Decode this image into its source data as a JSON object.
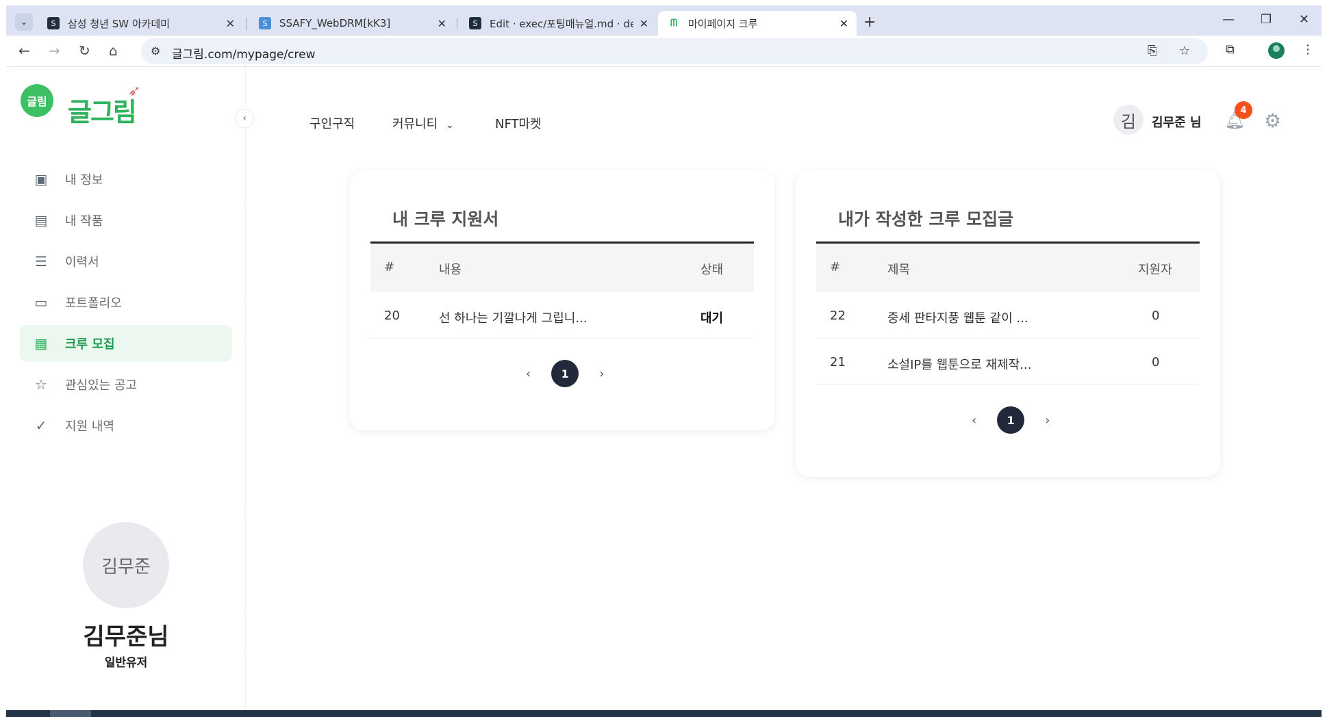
{
  "browser": {
    "tabs": [
      {
        "title": "삼성 청년 SW 아카데미",
        "favicon_color": "#1f2d3d"
      },
      {
        "title": "SSAFY_WebDRM[kK3]",
        "favicon_color": "#4a8fd8"
      },
      {
        "title": "Edit · exec/포팅매뉴얼.md · de",
        "favicon_color": "#1f2d3d"
      },
      {
        "title": "마이페이지 크루",
        "favicon_color": "#2db35b"
      }
    ],
    "url": "글그림.com/mypage/crew"
  },
  "sidebar": {
    "logo_mark": "글림",
    "logo_text": "글그림",
    "items": [
      {
        "label": "내 정보",
        "icon": "person-card-icon"
      },
      {
        "label": "내 작품",
        "icon": "archive-box-icon"
      },
      {
        "label": "이력서",
        "icon": "resume-list-icon"
      },
      {
        "label": "포트폴리오",
        "icon": "presentation-icon"
      },
      {
        "label": "크루 모집",
        "icon": "calendar-icon"
      },
      {
        "label": "관심있는 공고",
        "icon": "star-icon"
      },
      {
        "label": "지원 내역",
        "icon": "check-circle-icon"
      }
    ],
    "active_index": 4,
    "profile": {
      "avatar_text": "김무준",
      "name": "김무준님",
      "role": "일반유저"
    }
  },
  "topnav": {
    "items": [
      "구인구직",
      "커뮤니티",
      "NFT마켓"
    ],
    "user_initial": "김",
    "user_name": "김무준 님",
    "notification_count": "4"
  },
  "applications": {
    "title": "내 크루 지원서",
    "columns": [
      "#",
      "내용",
      "상태"
    ],
    "rows": [
      {
        "id": "20",
        "content": "선 하나는 기깔나게 그립니...",
        "status": "대기"
      }
    ],
    "current_page": "1"
  },
  "recruitments": {
    "title": "내가 작성한 크루 모집글",
    "columns": [
      "#",
      "제목",
      "지원자"
    ],
    "rows": [
      {
        "id": "22",
        "title": "중세 판타지풍 웹툰 같이 ...",
        "applicants": "0"
      },
      {
        "id": "21",
        "title": "소설IP를 웹툰으로 재제작...",
        "applicants": "0"
      }
    ],
    "current_page": "1"
  },
  "colors": {
    "accent": "#2db35b",
    "active_bg": "#ecf7f0",
    "pager": "#22293a",
    "badge": "#f4511e"
  }
}
